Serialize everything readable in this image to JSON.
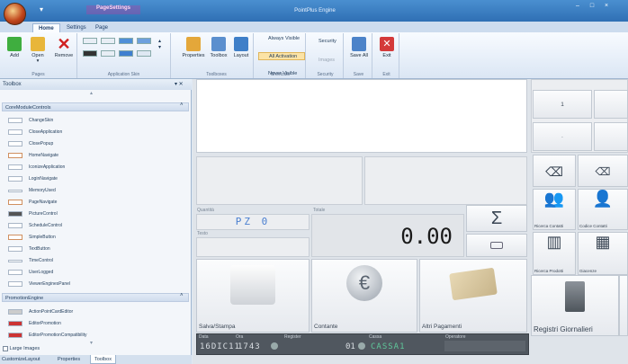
{
  "app": {
    "title": "PointPlus Engine",
    "context_tab": "PageSettings",
    "window_controls": "– □ ×"
  },
  "tabs": [
    "Home",
    "Settings",
    "Page"
  ],
  "ribbon": {
    "pages": {
      "label": "Pages",
      "add": "Add",
      "open": "Open",
      "remove": "Remove"
    },
    "skin": {
      "label": "Application Skin"
    },
    "toolboxes": {
      "label": "Toolboxes",
      "properties": "Properties",
      "toolbox": "Toolbox",
      "layout": "Layout"
    },
    "shortcuts": {
      "label": "Shortcuts",
      "always_visible": "Always Visible",
      "all_activation": "All Activation",
      "never_visible": "Never Visible"
    },
    "security": {
      "label": "Security",
      "security": "Security",
      "images": "Images"
    },
    "save": {
      "label": "Save",
      "save_all": "Save All"
    },
    "exit": {
      "label": "Exit",
      "exit": "Exit"
    }
  },
  "toolbox": {
    "title": "Toolbox",
    "pin": "▾ ✕",
    "cat1": "CoreModuleControls",
    "items1": [
      "ChangeSkin",
      "CloseApplication",
      "ClosePopup",
      "HomeNavigate",
      "IconizeApplication",
      "LoginNavigate",
      "MemoryUsed",
      "PageNavigate",
      "PictureControl",
      "ScheduleControl",
      "SimpleButton",
      "TextButton",
      "TimeControl",
      "UserLogged",
      "ViewerEnginesPanel"
    ],
    "cat2": "PromotionEngine",
    "items2": [
      "ActionPointCardEditor",
      "EditorPromotion",
      "EditorPromotionCompatibility"
    ],
    "large_images": "Large Images",
    "bottom_tabs": [
      "CustomizeLayout",
      "Properties",
      "Toolbox"
    ]
  },
  "pos": {
    "quantity_label": "Quantità",
    "quantity_value": "PZ 0",
    "total_label": "Totale",
    "total_value": "0.00",
    "text_label": "Testo",
    "sigma": "Σ",
    "save_print": "Salva/Stampa",
    "cash": "Contante",
    "other_payments": "Altri Pagamenti",
    "daily_registers": "Registri Giornalieri",
    "keypad_value": "1",
    "keypad_dot": "·",
    "side_tiles": [
      "Ricerca Contatti",
      "Codice Contatti",
      "Ricerca Prodotti",
      "Giacenze"
    ],
    "status": {
      "data_label": "Data",
      "data_value": "16DIC11",
      "ora_label": "Ora",
      "ora_value": "1743",
      "register_label": "Register",
      "register_value": "01",
      "cassa_label": "Cassa",
      "cassa_value": "CASSA1",
      "operatore_label": "Operatore",
      "operatore_value": ""
    }
  }
}
